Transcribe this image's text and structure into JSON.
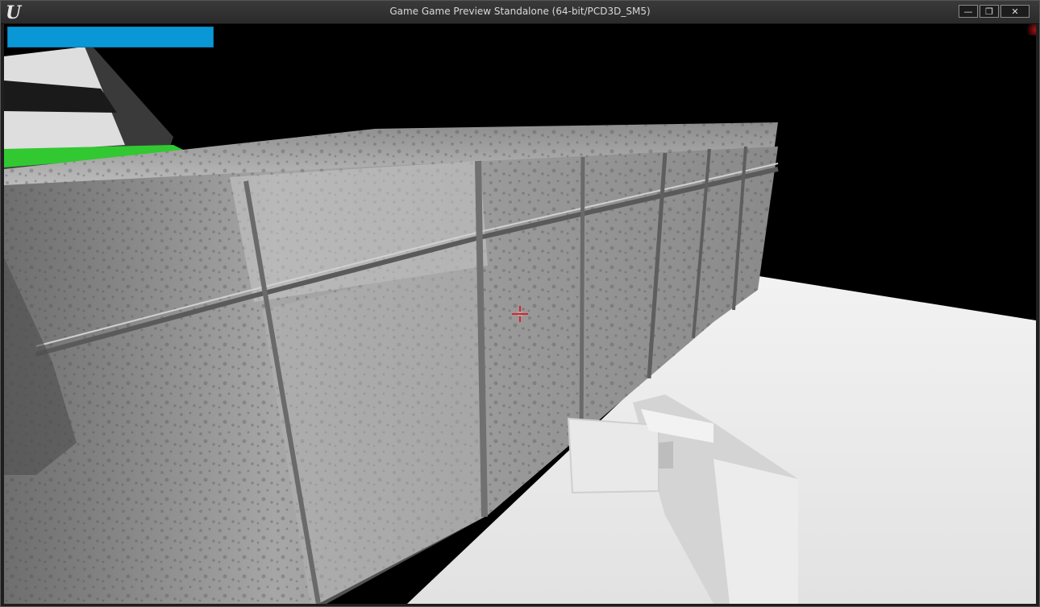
{
  "window": {
    "title": "Game Game Preview Standalone (64-bit/PCD3D_SM5)",
    "logo_text": "U",
    "controls": {
      "minimize_label": "—",
      "maximize_label": "❐",
      "close_label": "✕"
    }
  },
  "hud": {
    "health_bar_color": "#0a97d6",
    "health_fraction": 1.0,
    "crosshair_color": "#e0202a"
  },
  "scene": {
    "floor_color": "#e6e6e6",
    "wall_color": "#9a9a9a",
    "platform_color": "#32c832",
    "background_color": "#000000"
  }
}
